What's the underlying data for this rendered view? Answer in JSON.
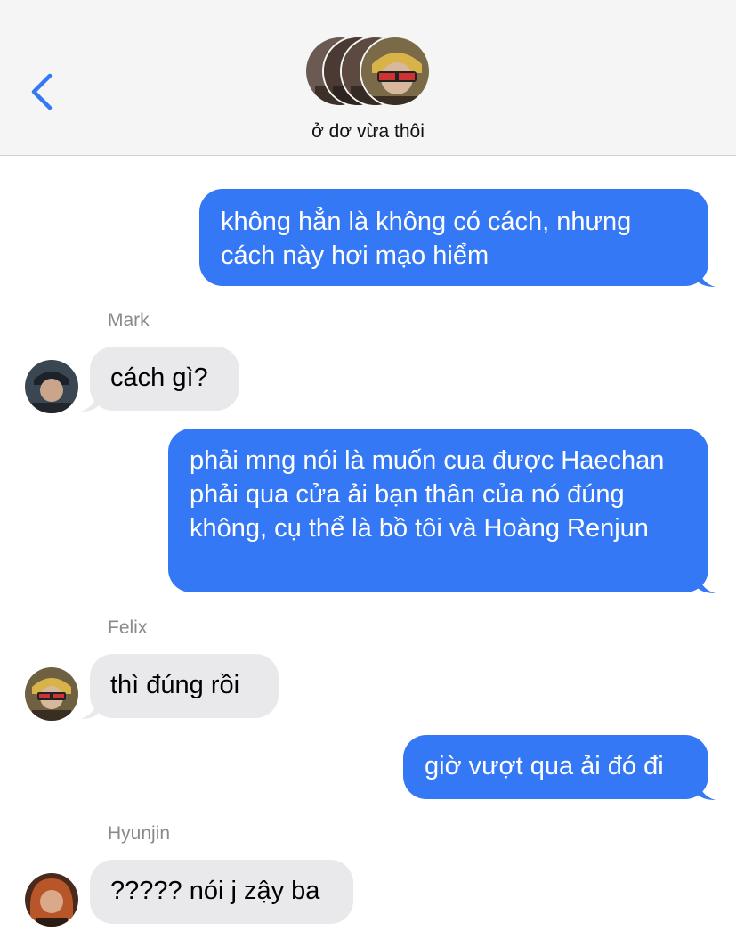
{
  "header": {
    "back_icon": "chevron-left-icon",
    "group_name": "ở dơ vừa thôi",
    "accent": "#3478f6",
    "background": "#f5f5f5"
  },
  "messages": [
    {
      "direction": "outgoing",
      "text": "không hẳn là không có cách, nhưng cách này hơi mạo hiểm"
    },
    {
      "direction": "incoming",
      "sender": "Mark",
      "text": "cách gì?"
    },
    {
      "direction": "outgoing",
      "text": "phải mng nói là muốn cua được Haechan phải qua cửa ải bạn thân của nó đúng không, cụ thể là bồ tôi và Hoàng Renjun"
    },
    {
      "direction": "incoming",
      "sender": "Felix",
      "text": "thì đúng rồi"
    },
    {
      "direction": "outgoing",
      "text": "giờ vượt qua ải đó đi"
    },
    {
      "direction": "incoming",
      "sender": "Hyunjin",
      "text": "????? nói j zậy ba"
    }
  ],
  "colors": {
    "outgoing_bubble": "#3478f6",
    "incoming_bubble": "#e9e9eb",
    "sender_name": "#8a8a8e"
  }
}
